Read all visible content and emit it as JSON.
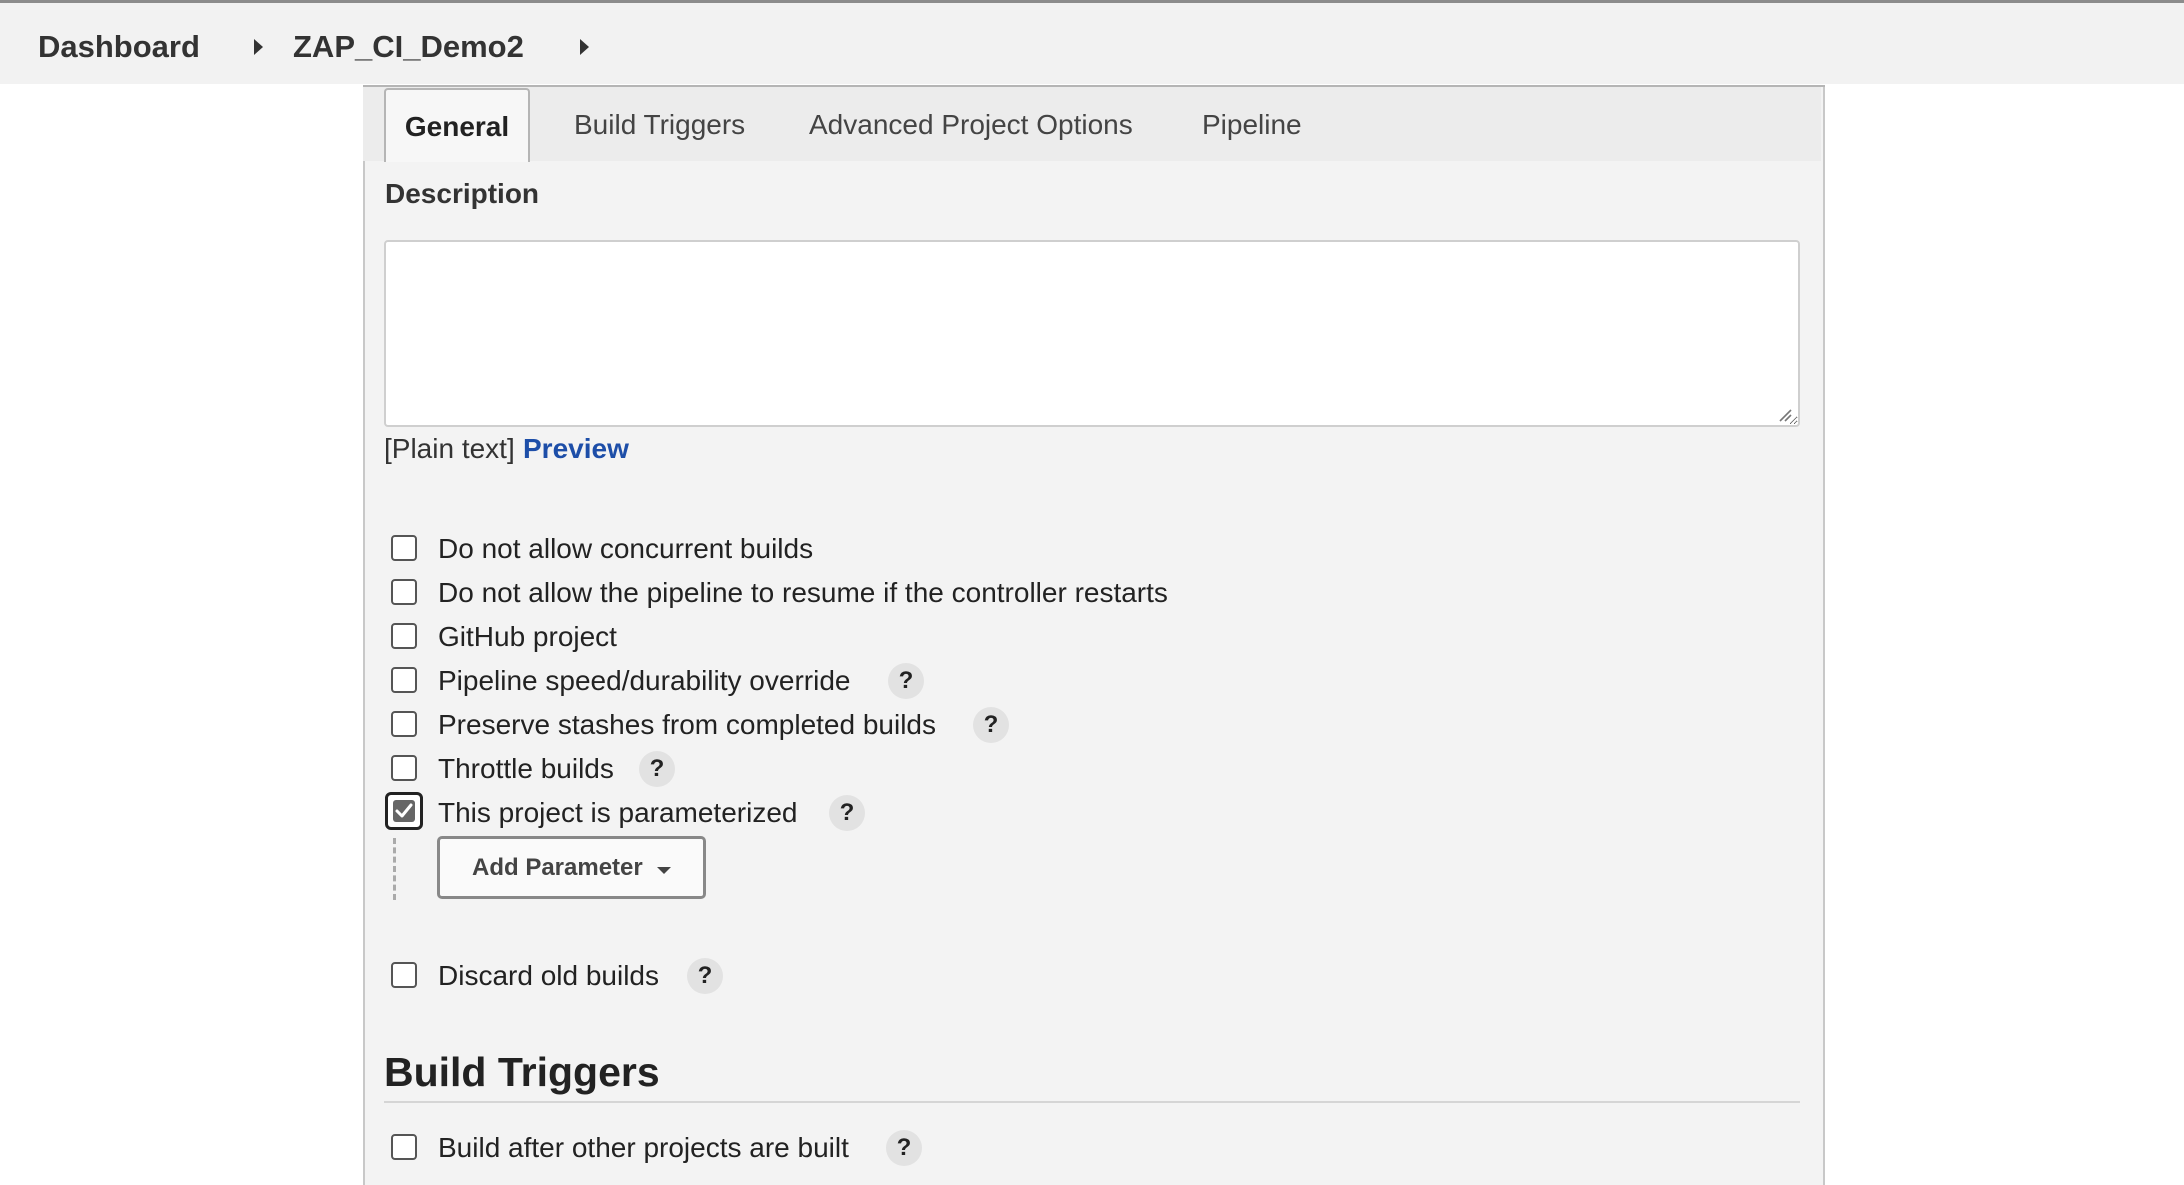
{
  "breadcrumb": {
    "items": [
      "Dashboard",
      "ZAP_CI_Demo2"
    ]
  },
  "tabs": [
    {
      "label": "General",
      "active": true
    },
    {
      "label": "Build Triggers",
      "active": false
    },
    {
      "label": "Advanced Project Options",
      "active": false
    },
    {
      "label": "Pipeline",
      "active": false
    }
  ],
  "general": {
    "description_label": "Description",
    "description_value": "",
    "format_note": "[Plain text]",
    "preview_link": "Preview",
    "options": [
      {
        "label": "Do not allow concurrent builds",
        "checked": false,
        "help": false
      },
      {
        "label": "Do not allow the pipeline to resume if the controller restarts",
        "checked": false,
        "help": false
      },
      {
        "label": "GitHub project",
        "checked": false,
        "help": false
      },
      {
        "label": "Pipeline speed/durability override",
        "checked": false,
        "help": true
      },
      {
        "label": "Preserve stashes from completed builds",
        "checked": false,
        "help": true
      },
      {
        "label": "Throttle builds",
        "checked": false,
        "help": true
      },
      {
        "label": "This project is parameterized",
        "checked": true,
        "help": true
      },
      {
        "label": "Discard old builds",
        "checked": false,
        "help": true
      }
    ],
    "add_parameter_label": "Add Parameter",
    "help_glyph": "?"
  },
  "build_triggers": {
    "title": "Build Triggers",
    "options": [
      {
        "label": "Build after other projects are built",
        "checked": false,
        "help": true
      }
    ]
  },
  "colors": {
    "link": "#1d4ea8",
    "breadcrumb_bg": "#f2f2f2",
    "panel_bg": "#f3f3f3"
  }
}
